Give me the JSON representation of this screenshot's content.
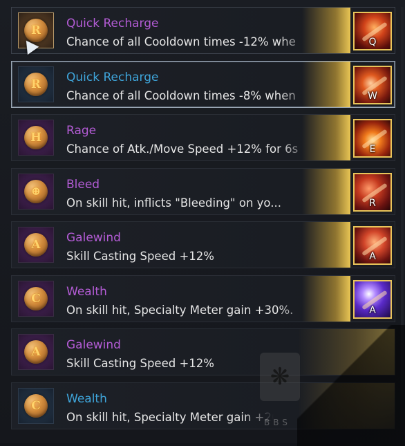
{
  "runes": [
    {
      "name": "Quick Recharge",
      "desc": "Chance of all Cooldown times -12% whe",
      "glyph": "R",
      "name_color": "purple",
      "frame": "legend",
      "key": "Q",
      "art": "q",
      "state": "hover"
    },
    {
      "name": "Quick Recharge",
      "desc": "Chance of all Cooldown times -8% when",
      "glyph": "R",
      "name_color": "blue",
      "frame": "blue",
      "key": "W",
      "art": "w",
      "state": "selected"
    },
    {
      "name": "Rage",
      "desc": "Chance of Atk./Move Speed +12% for 6s",
      "glyph": "H",
      "name_color": "purple",
      "frame": "purple",
      "key": "E",
      "art": "e",
      "state": ""
    },
    {
      "name": "Bleed",
      "desc": "On skill hit, inflicts \"Bleeding\" on yo...",
      "glyph": "⊕",
      "name_color": "purple",
      "frame": "purple",
      "key": "R",
      "art": "r",
      "state": ""
    },
    {
      "name": "Galewind",
      "desc": "Skill Casting Speed +12%",
      "glyph": "A",
      "name_color": "purple",
      "frame": "purple",
      "key": "A",
      "art": "a1",
      "state": ""
    },
    {
      "name": "Wealth",
      "desc": "On skill hit, Specialty Meter gain +30%.",
      "glyph": "C",
      "name_color": "purple",
      "frame": "purple",
      "key": "A",
      "art": "a2",
      "state": ""
    },
    {
      "name": "Galewind",
      "desc": "Skill Casting Speed +12%",
      "glyph": "A",
      "name_color": "purple",
      "frame": "purple",
      "key": "",
      "art": "",
      "state": ""
    },
    {
      "name": "Wealth",
      "desc": "On skill hit, Specialty Meter gain +20%.",
      "glyph": "C",
      "name_color": "blue",
      "frame": "blue",
      "key": "",
      "art": "",
      "state": ""
    }
  ],
  "watermark": {
    "text": "BBS",
    "icon": "paw-icon"
  },
  "colors": {
    "purple": "#b45cd6",
    "blue": "#3fa6dc",
    "gold": "#e8c45a",
    "text": "#e6e6e6"
  }
}
